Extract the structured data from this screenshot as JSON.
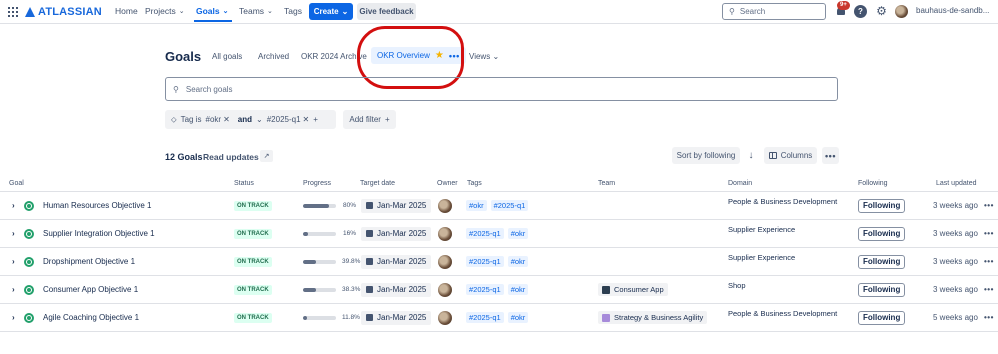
{
  "topnav": {
    "brand": "ATLASSIAN",
    "items": [
      {
        "label": "Home"
      },
      {
        "label": "Projects"
      },
      {
        "label": "Goals"
      },
      {
        "label": "Teams"
      },
      {
        "label": "Tags"
      }
    ],
    "create_label": "Create",
    "feedback_label": "Give feedback",
    "search_placeholder": "Search",
    "notification_count": "9+",
    "help_glyph": "?",
    "profile_name": "bauhaus-de-sandb..."
  },
  "header": {
    "title": "Goals",
    "tabs": [
      {
        "label": "All goals"
      },
      {
        "label": "Archived"
      },
      {
        "label": "OKR 2024 Archive"
      },
      {
        "label": "OKR Overview"
      },
      {
        "label": "Views"
      }
    ],
    "search_placeholder": "Search goals"
  },
  "filters": {
    "tag_prefix": "Tag is",
    "value1": "#okr",
    "conjunction": "and",
    "value2": "#2025-q1",
    "add_filter_label": "Add filter"
  },
  "toolbar": {
    "count_label": "12 Goals",
    "read_updates_label": "Read updates",
    "sort_label": "Sort by following",
    "columns_label": "Columns"
  },
  "table": {
    "columns": [
      "Goal",
      "Status",
      "Progress",
      "Target date",
      "Owner",
      "Tags",
      "Team",
      "Domain",
      "Following",
      "Last updated"
    ],
    "rows": [
      {
        "name": "Human Resources Objective 1",
        "status": "ON TRACK",
        "progress_text": "80%",
        "progress": 0.8,
        "target": "Jan-Mar 2025",
        "tags": [
          "#okr",
          "#2025-q1"
        ],
        "team": "",
        "domain": "People & Business Development",
        "following": "Following",
        "updated": "3 weeks ago"
      },
      {
        "name": "Supplier Integration Objective 1",
        "status": "ON TRACK",
        "progress_text": "16%",
        "progress": 0.16,
        "target": "Jan-Mar 2025",
        "tags": [
          "#2025-q1",
          "#okr"
        ],
        "team": "",
        "domain": "Supplier Experience",
        "following": "Following",
        "updated": "3 weeks ago"
      },
      {
        "name": "Dropshipment Objective 1",
        "status": "ON TRACK",
        "progress_text": "39.8%",
        "progress": 0.398,
        "target": "Jan-Mar 2025",
        "tags": [
          "#2025-q1",
          "#okr"
        ],
        "team": "",
        "domain": "Supplier Experience",
        "following": "Following",
        "updated": "3 weeks ago"
      },
      {
        "name": "Consumer App Objective 1",
        "status": "ON TRACK",
        "progress_text": "38.3%",
        "progress": 0.383,
        "target": "Jan-Mar 2025",
        "tags": [
          "#2025-q1",
          "#okr"
        ],
        "team": "Consumer App",
        "team_color": "#2c3e50",
        "domain": "Shop",
        "following": "Following",
        "updated": "3 weeks ago"
      },
      {
        "name": "Agile Coaching Objective 1",
        "status": "ON TRACK",
        "progress_text": "11.8%",
        "progress": 0.118,
        "target": "Jan-Mar 2025",
        "tags": [
          "#2025-q1",
          "#okr"
        ],
        "team": "Strategy & Business Agility",
        "team_color": "#a78bda",
        "domain": "People & Business Development",
        "following": "Following",
        "updated": "5 weeks ago"
      }
    ]
  },
  "colors": {
    "accent": "#0c66e4",
    "status_bg": "#dcfff1",
    "status_fg": "#216e4e",
    "annotation": "#d30f0f"
  }
}
